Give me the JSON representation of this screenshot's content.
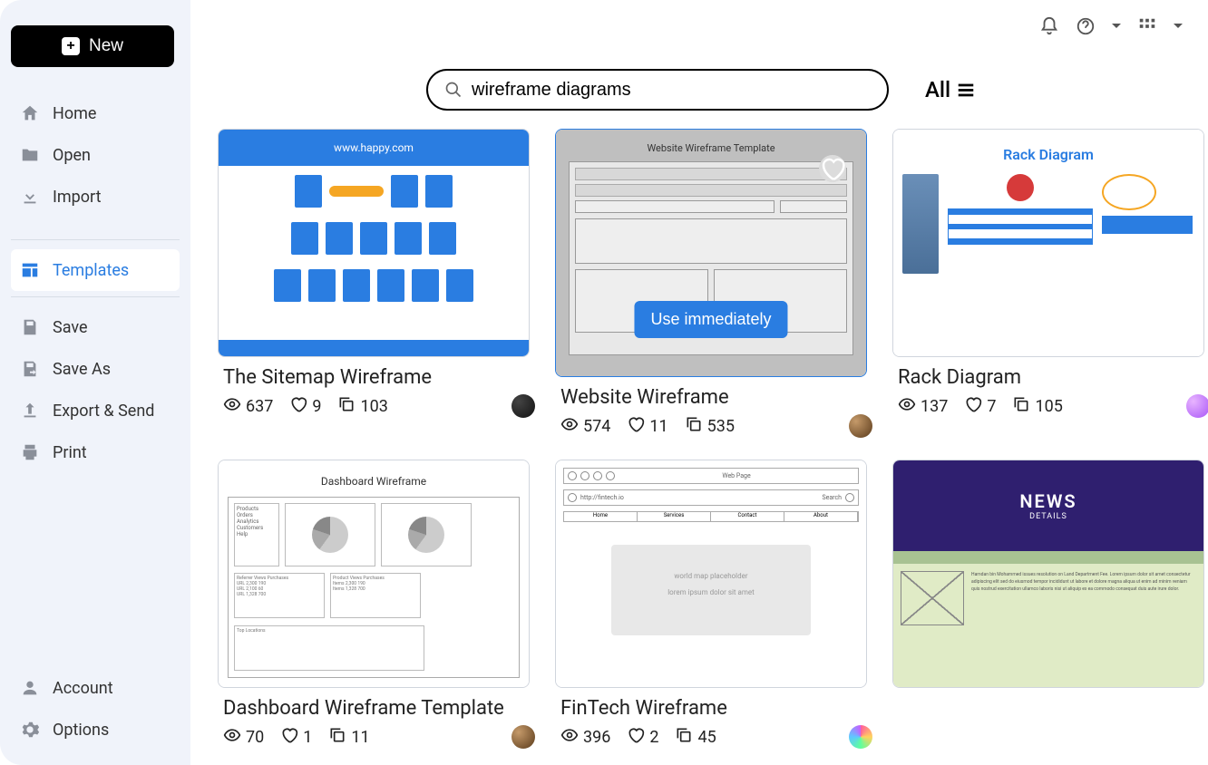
{
  "newButton": "New",
  "sidebar": [
    {
      "id": "home",
      "label": "Home"
    },
    {
      "id": "open",
      "label": "Open"
    },
    {
      "id": "import",
      "label": "Import"
    },
    {
      "id": "templates",
      "label": "Templates"
    },
    {
      "id": "save",
      "label": "Save"
    },
    {
      "id": "saveas",
      "label": "Save As"
    },
    {
      "id": "export",
      "label": "Export & Send"
    },
    {
      "id": "print",
      "label": "Print"
    },
    {
      "id": "account",
      "label": "Account"
    },
    {
      "id": "options",
      "label": "Options"
    }
  ],
  "search": {
    "value": "wireframe diagrams"
  },
  "filter": {
    "label": "All"
  },
  "useImmediatelyLabel": "Use immediately",
  "templates": [
    {
      "title": "The Sitemap Wireframe",
      "views": "637",
      "likes": "9",
      "copies": "103",
      "mock": "sitemap",
      "mockHeader": "www.happy.com",
      "hovered": false,
      "avatar": "dark"
    },
    {
      "title": "Website Wireframe",
      "views": "574",
      "likes": "11",
      "copies": "535",
      "mock": "website",
      "mockHeader": "Website Wireframe Template",
      "hovered": true,
      "avatar": "default"
    },
    {
      "title": "Rack Diagram",
      "views": "137",
      "likes": "7",
      "copies": "105",
      "mock": "rack",
      "mockHeader": "Rack Diagram",
      "hovered": false,
      "avatar": "purple"
    },
    {
      "title": "Dashboard Wireframe Template",
      "views": "70",
      "likes": "1",
      "copies": "11",
      "mock": "dashboard",
      "mockHeader": "Dashboard Wireframe",
      "hovered": false,
      "avatar": "default"
    },
    {
      "title": "FinTech Wireframe",
      "views": "396",
      "likes": "2",
      "copies": "45",
      "mock": "fintech",
      "mockHeader": "Web Page",
      "hovered": false,
      "avatar": "rainbow"
    },
    {
      "title": "",
      "views": "",
      "likes": "",
      "copies": "",
      "mock": "news",
      "mockHeader": "NEWS",
      "mockSub": "DETAILS",
      "hovered": false,
      "avatar": ""
    }
  ]
}
